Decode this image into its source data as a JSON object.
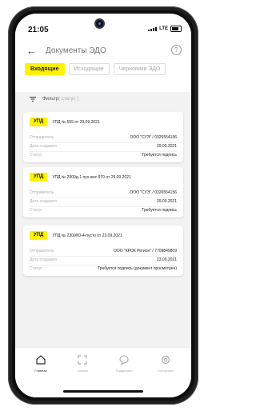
{
  "status_bar": {
    "time": "21:05",
    "network": "LTE"
  },
  "header": {
    "title": "Документы ЭДО"
  },
  "tabs": [
    {
      "label": "Входящие",
      "active": true
    },
    {
      "label": "Исходящие",
      "active": false
    },
    {
      "label": "Черновики ЭДО",
      "active": false
    }
  ],
  "filter": {
    "label": "Фильтр",
    "hint": "( статус )"
  },
  "documents": [
    {
      "badge": "УПД",
      "title": "УПД № 555 от 29.09.2021",
      "rows": [
        {
          "label": "Отправитель",
          "value": "ООО \"СУЭ\" / 0326554156"
        },
        {
          "label": "Дата создания",
          "value": "29.09.2021"
        },
        {
          "label": "Статус",
          "value": "Требуется подпись"
        }
      ]
    },
    {
      "badge": "УПД",
      "title": "УПД № 2909д-1 пух жос 970 от 29.09.2021",
      "rows": [
        {
          "label": "Отправитель",
          "value": "ООО \"СУЭ\" / 0326554156"
        },
        {
          "label": "Дата создания",
          "value": "29.09.2021"
        },
        {
          "label": "Статус",
          "value": "Требуется подпись"
        }
      ]
    },
    {
      "badge": "УПД",
      "title": "УПД № 2309/Ю-4-пусто от 23.09.2021",
      "rows": [
        {
          "label": "Отправитель",
          "value": "ООО \"КРОК Регион\" / 7709849809"
        },
        {
          "label": "Дата создания",
          "value": "23.09.2021"
        },
        {
          "label": "Статус",
          "value": "Требуется подпись (документ просмотрен)"
        }
      ]
    }
  ],
  "bottom_nav": [
    {
      "label": "Главная",
      "icon": "home-icon",
      "active": true
    },
    {
      "label": "Сканер",
      "icon": "scan-icon",
      "active": false
    },
    {
      "label": "Поддержка",
      "icon": "chat-icon",
      "active": false
    },
    {
      "label": "Настройки",
      "icon": "gear-icon",
      "active": false
    }
  ],
  "colors": {
    "accent": "#fff200",
    "background": "#f2f2f2"
  }
}
